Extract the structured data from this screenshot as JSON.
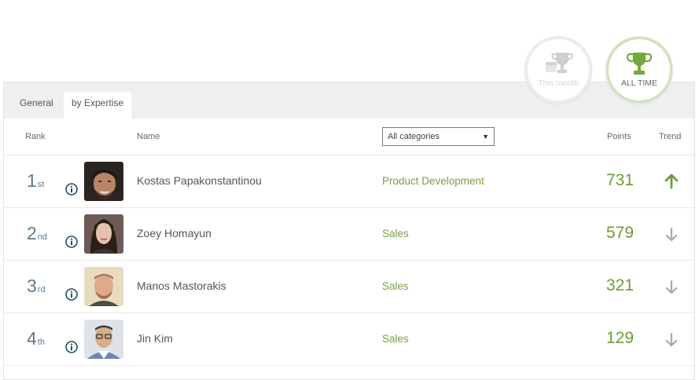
{
  "periods": {
    "this_month": {
      "label": "This month",
      "icon": "trophy-calendar-icon",
      "active": false
    },
    "all_time": {
      "label": "ALL TIME",
      "icon": "trophy-icon",
      "active": true
    }
  },
  "tabs": [
    {
      "label": "General",
      "active": false
    },
    {
      "label": "by Expertise",
      "active": true
    }
  ],
  "columns": {
    "rank": "Rank",
    "name": "Name",
    "points": "Points",
    "trend": "Trend"
  },
  "category_filter": {
    "selected": "All categories"
  },
  "colors": {
    "accent": "#6f9a3a",
    "rank": "#5f7a8c",
    "trend_up": "#6f9a3a",
    "trend_down": "#a8a8a8"
  },
  "leaders": [
    {
      "rank": "1",
      "suffix": "st",
      "name": "Kostas Papakonstantinou",
      "category": "Product Development",
      "points": "731",
      "trend": "up"
    },
    {
      "rank": "2",
      "suffix": "nd",
      "name": "Zoey Homayun",
      "category": "Sales",
      "points": "579",
      "trend": "down"
    },
    {
      "rank": "3",
      "suffix": "rd",
      "name": "Manos Mastorakis",
      "category": "Sales",
      "points": "321",
      "trend": "down"
    },
    {
      "rank": "4",
      "suffix": "th",
      "name": "Jin Kim",
      "category": "Sales",
      "points": "129",
      "trend": "down"
    }
  ]
}
